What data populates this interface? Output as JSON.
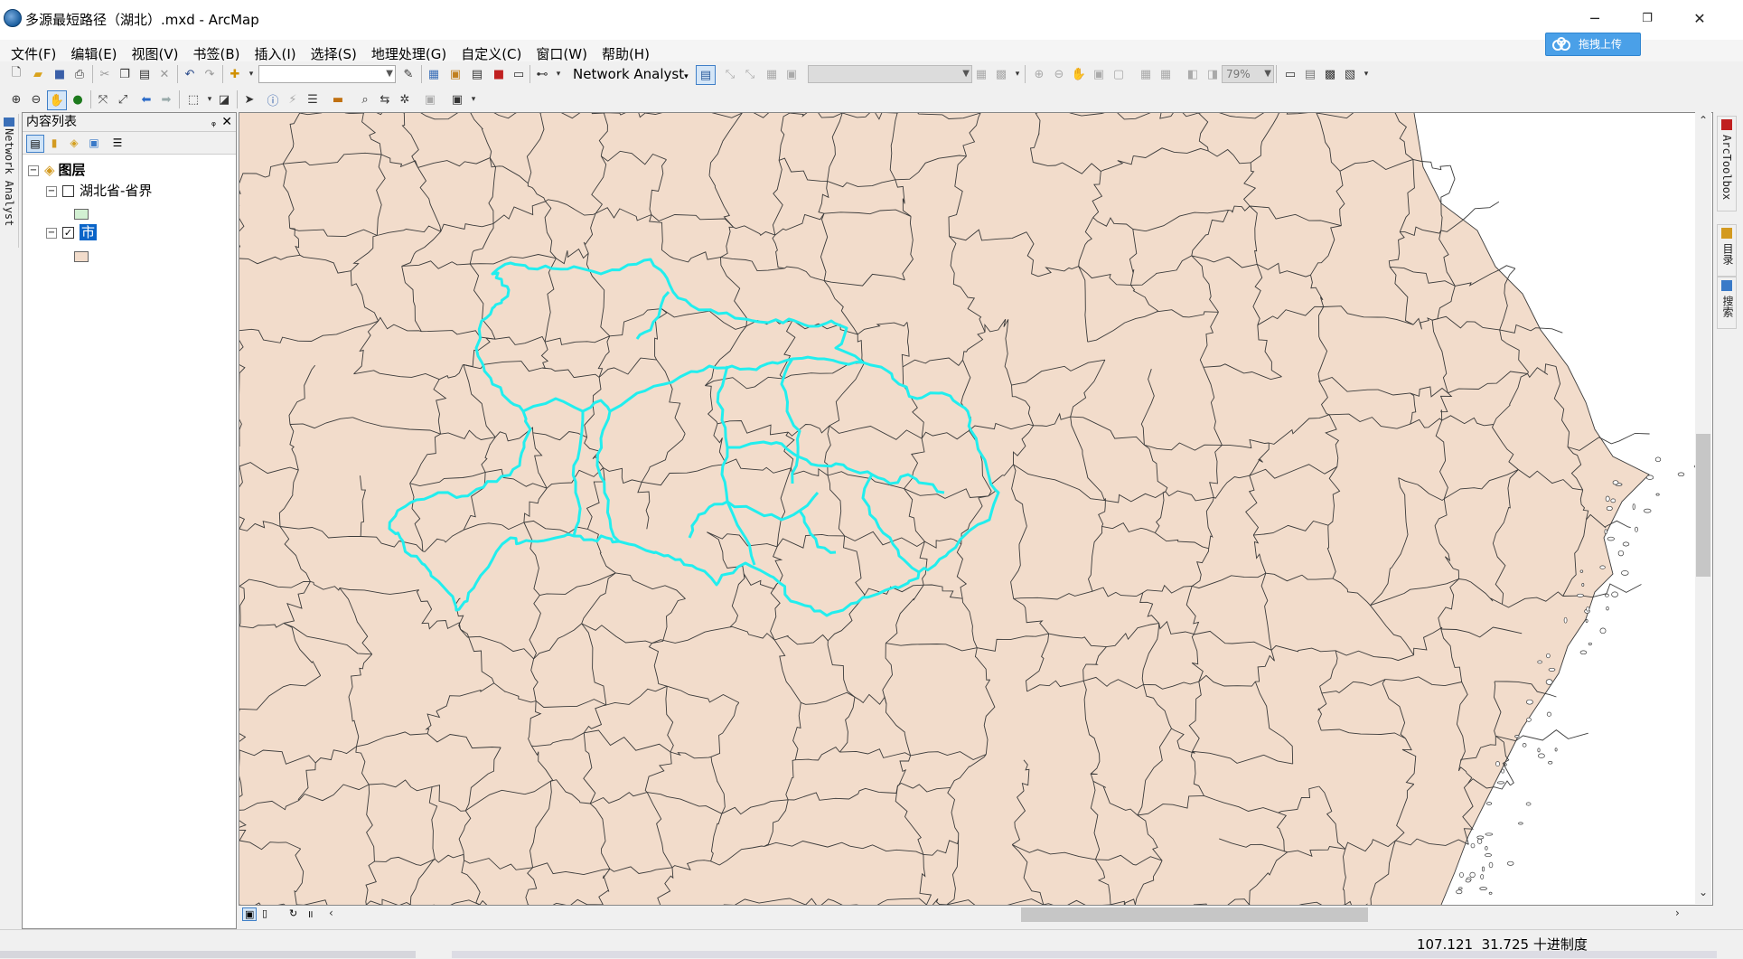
{
  "window": {
    "title": "多源最短路径（湖北）.mxd - ArcMap",
    "minimize": "─",
    "restore": "❐",
    "close": "✕"
  },
  "menu": [
    {
      "label": "文件(F)"
    },
    {
      "label": "编辑(E)"
    },
    {
      "label": "视图(V)"
    },
    {
      "label": "书签(B)"
    },
    {
      "label": "插入(I)"
    },
    {
      "label": "选择(S)"
    },
    {
      "label": "地理处理(G)"
    },
    {
      "label": "自定义(C)"
    },
    {
      "label": "窗口(W)"
    },
    {
      "label": "帮助(H)"
    }
  ],
  "upload_button": {
    "label": "拖拽上传"
  },
  "toolbar": {
    "network_analyst_label": "Network Analyst",
    "scale_value": "",
    "zoom_percent": "79%"
  },
  "left_tab": {
    "label": "Network Analyst"
  },
  "toc": {
    "title": "内容列表",
    "pin": "ᵩ",
    "close": "✕",
    "root": {
      "label": "图层"
    },
    "layers": [
      {
        "label": "湖北省-省界",
        "checked": false,
        "swatch_color": "#d2f0d2"
      },
      {
        "label": "市",
        "checked": true,
        "swatch_color": "#f2dccb"
      }
    ]
  },
  "right_dock": [
    {
      "label": "ArcToolbox"
    },
    {
      "label": "目录"
    },
    {
      "label": "搜索"
    }
  ],
  "map": {
    "fill_color": "#f2dccb",
    "boundary_color": "#3b3b3b",
    "highlight_color": "#22eeee"
  },
  "status": {
    "x": "107.121",
    "y": "31.725",
    "units": "十进制度"
  }
}
